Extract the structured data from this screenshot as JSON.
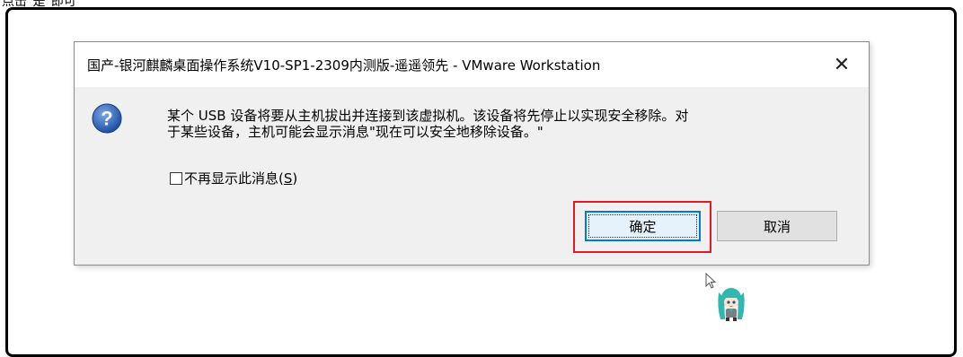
{
  "top_caption": "点击\"是\"即可",
  "dialog": {
    "title": "国产-银河麒麟桌面操作系统V10-SP1-2309内测版-遥遥领先 - VMware Workstation",
    "close_glyph": "✕",
    "message_line1": "某个 USB 设备将要从主机拔出并连接到该虚拟机。该设备将先停止以实现安全移除。对",
    "message_line2": "于某些设备，主机可能会显示消息\"现在可以安全地移除设备。\"",
    "checkbox_label": "不再显示此消息(",
    "checkbox_hotkey": "S",
    "checkbox_label_end": ")",
    "checkbox_checked": false,
    "ok_label": "确定",
    "cancel_label": "取消"
  },
  "colors": {
    "highlight": "#e01b24",
    "icon_blue": "#1f4fa3"
  },
  "icons": {
    "question": "question-icon",
    "cursor": "arrow-cursor-icon",
    "mascot": "anime-mascot-icon"
  }
}
